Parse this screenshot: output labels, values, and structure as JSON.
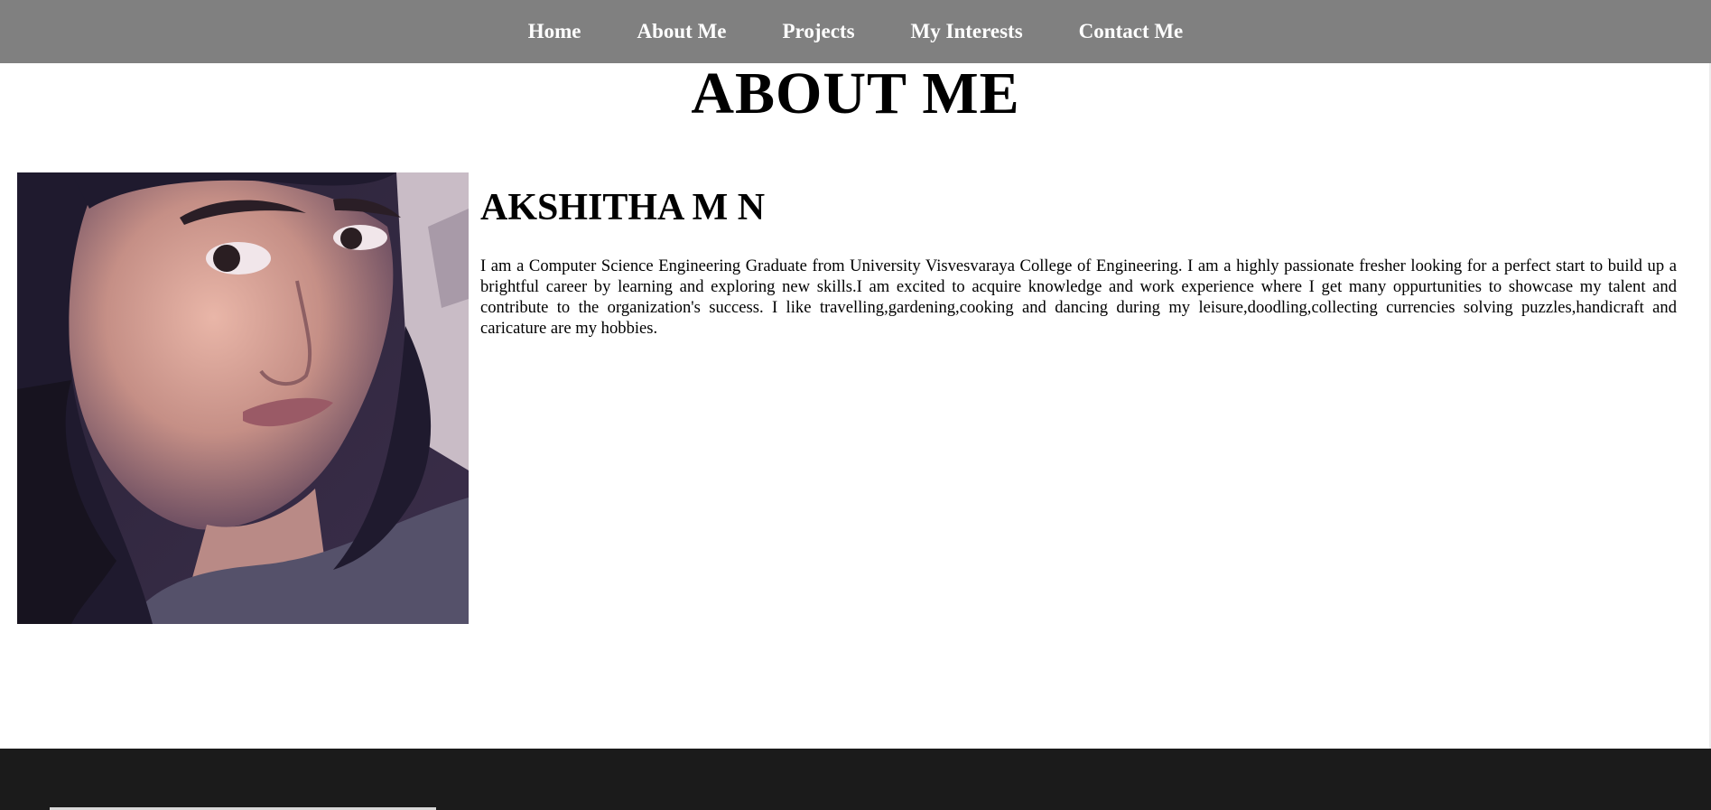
{
  "nav": {
    "items": [
      {
        "label": "Home"
      },
      {
        "label": "About Me"
      },
      {
        "label": "Projects"
      },
      {
        "label": "My Interests"
      },
      {
        "label": "Contact Me"
      }
    ]
  },
  "page": {
    "title": "ABOUT ME"
  },
  "profile": {
    "name": "AKSHITHA M N",
    "bio": "I am a Computer Science Engineering Graduate from University Visvesvaraya College of Engineering. I am a highly passionate fresher looking for a perfect start to build up a brightful career by learning and exploring new skills.I am excited to acquire knowledge and work experience where I get many oppurtunities to showcase my talent and contribute to the organization's success. I like travelling,gardening,cooking and dancing during my leisure,doodling,collecting currencies solving puzzles,handicraft and caricature are my hobbies."
  },
  "colors": {
    "navbar_bg": "#808080",
    "nav_text": "#ffffff",
    "footer_bg": "#1b1b1b"
  }
}
